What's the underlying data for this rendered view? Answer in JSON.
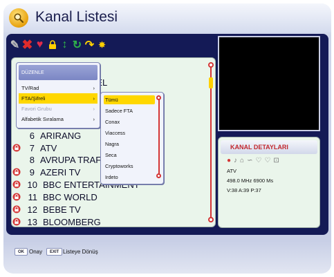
{
  "header": {
    "title": "Kanal Listesi"
  },
  "toolbar_icons": [
    "edit-icon",
    "delete-icon",
    "favorite-icon",
    "lock-icon",
    "move-icon",
    "rename-icon",
    "skip-icon",
    "star-icon"
  ],
  "channel_list": {
    "header_fragment": "NEL",
    "rows": [
      {
        "num": "6",
        "name": "ARIRANG",
        "locked": false
      },
      {
        "num": "7",
        "name": "ATV",
        "locked": true
      },
      {
        "num": "8",
        "name": "AVRUPA TRAFIK",
        "locked": false
      },
      {
        "num": "9",
        "name": "AZERI TV",
        "locked": true
      },
      {
        "num": "10",
        "name": "BBC ENTERTAINMENT",
        "locked": true
      },
      {
        "num": "11",
        "name": "BBC WORLD",
        "locked": true
      },
      {
        "num": "12",
        "name": "BEBE TV",
        "locked": true
      },
      {
        "num": "13",
        "name": "BLOOMBERG",
        "locked": true
      }
    ]
  },
  "edit_menu": {
    "title": "DÜZENLE",
    "items": [
      {
        "label": "TV/Rad",
        "arrow": "›",
        "state": "normal"
      },
      {
        "label": "FTA/Şifreli",
        "arrow": "›",
        "state": "selected"
      },
      {
        "label": "Favori Grubu",
        "arrow": "›",
        "state": "disabled"
      },
      {
        "label": "Alfabetik Sıralama",
        "arrow": "›",
        "state": "normal"
      }
    ]
  },
  "fta_submenu": {
    "items": [
      "Tümü",
      "Sadece FTA",
      "Conax",
      "Viaccess",
      "Nagra",
      "Seca",
      "Cryptoworks",
      "Irdeto"
    ],
    "selected": "Tümü"
  },
  "details": {
    "title": "KANAL DETAYLARI",
    "channel": "ATV",
    "freq_line": "498.0  MHz  6900  Ms",
    "pid_line": "V:38  A:39  P:37"
  },
  "footer": {
    "ok_key": "OK",
    "ok_label": "Onay",
    "exit_key": "EXIT",
    "exit_label": "Listeye Dönüş"
  },
  "colors": {
    "navy": "#141a56",
    "accent_yellow": "#ffd700",
    "lock_red": "#d43535",
    "details_title": "#c1272d"
  }
}
